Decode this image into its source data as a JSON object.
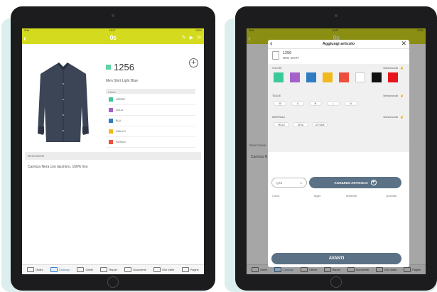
{
  "tabs": [
    {
      "label": "Ordini"
    },
    {
      "label": "Catalogo"
    },
    {
      "label": "Clienti"
    },
    {
      "label": "Report"
    },
    {
      "label": "Documenti"
    },
    {
      "label": "Giro Visite"
    },
    {
      "label": "Pagine"
    }
  ],
  "app": {
    "logo": "0s",
    "status_left": "iPad",
    "status_time": "18:27",
    "status_right": "100%"
  },
  "product": {
    "code": "1256",
    "code_color": "#5ed3a4",
    "name": "Men Shirt Light Blue",
    "colors_header": "Colori",
    "colors": [
      {
        "name": "VERDE",
        "hex": "#3cc99a"
      },
      {
        "name": "LILLA",
        "hex": "#a561c9"
      },
      {
        "name": "BLU",
        "hex": "#2f7cc3"
      },
      {
        "name": "GIALLO",
        "hex": "#f2b91d"
      },
      {
        "name": "ROSSO",
        "hex": "#ee4f3c"
      }
    ],
    "description_header": "Descrizione",
    "description": "Camicia Nera con taschino, 100% lino"
  },
  "modal": {
    "title": "Aggiungi articolo",
    "item_code": "1256",
    "item_name": "MEN SHIRT",
    "colors_label": "COLORI",
    "sizes_label": "TAGLIE",
    "materials_label": "MATERIALI",
    "select_all": "Seleziona tutti",
    "swatches": [
      "#3cc99a",
      "#a561c9",
      "#2f7cc3",
      "#f2b91d",
      "#ee4f3c",
      "#ffffff",
      "#111111",
      "#e8151b"
    ],
    "sizes": [
      "XS",
      "S",
      "M",
      "L",
      "XL"
    ],
    "materials": [
      "PELLE",
      "SETA",
      "COTONE"
    ],
    "qty_label": "QTÀ",
    "qty_value": "1",
    "add_label": "AGGIUNGI ARTICOLO",
    "columns": [
      "Colori",
      "Taglie",
      "Materiali",
      "Quantità"
    ],
    "next_label": "AVANTI"
  },
  "right_bg": {
    "desc_fragment": "Descrizione",
    "text_fragment": "Camicia N"
  }
}
